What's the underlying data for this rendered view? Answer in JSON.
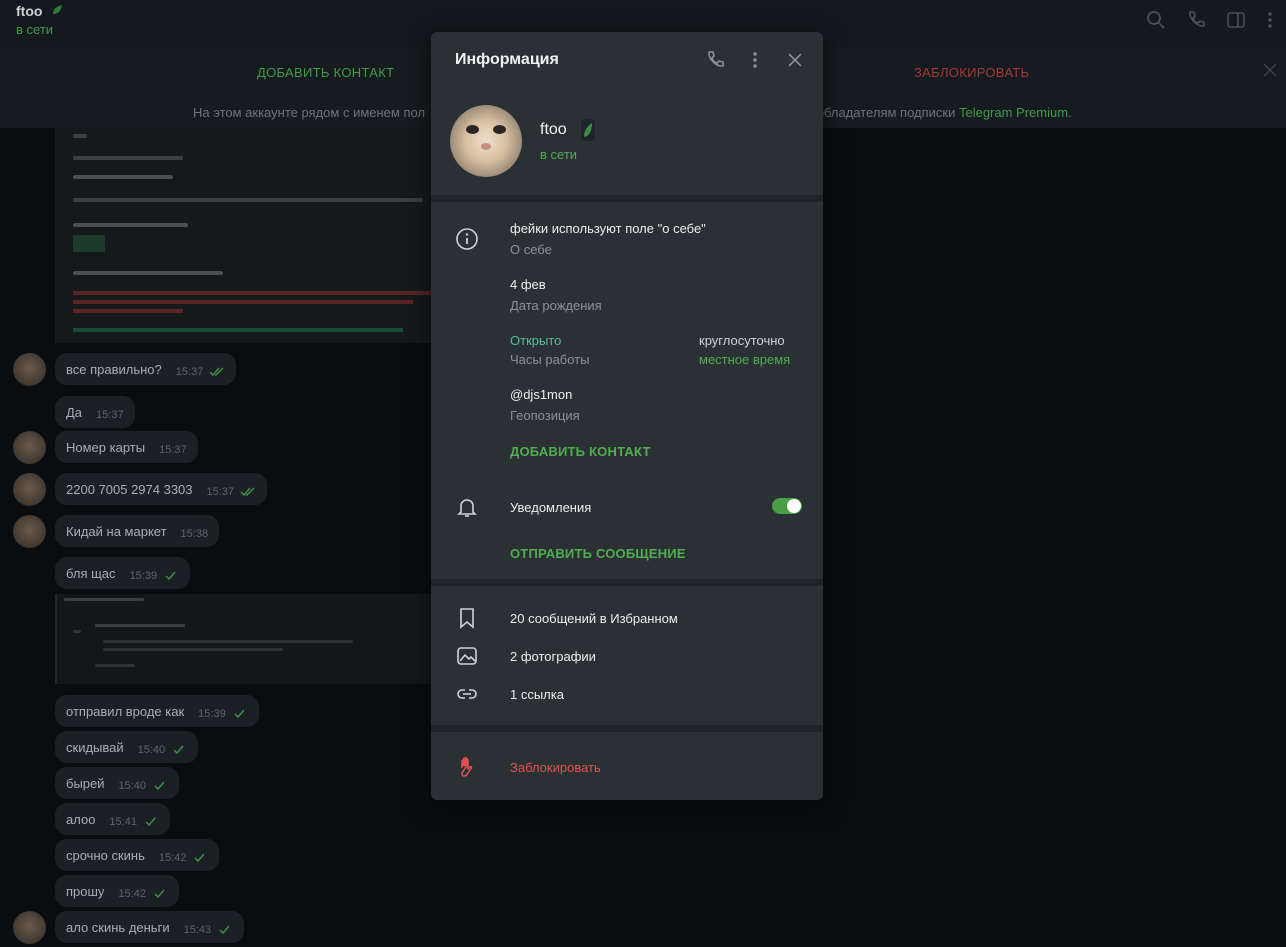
{
  "chat": {
    "contact_name": "ftoo",
    "contact_status": "в сети",
    "action_add": "ДОБАВИТЬ КОНТАКТ",
    "action_block": "ЗАБЛОКИРОВАТЬ",
    "note_prefix": "На этом аккаунте рядом с именем пол",
    "note_suffix": "ем обладателям подписки ",
    "note_premium": "Telegram Premium.",
    "messages": [
      {
        "text": "все правильно?",
        "time": "15:37",
        "checks": "double"
      },
      {
        "text": "Да",
        "time": "15:37",
        "checks": "none"
      },
      {
        "text": "Номер карты",
        "time": "15:37",
        "checks": "none"
      },
      {
        "text": "2200 7005 2974 3303",
        "time": "15:37",
        "checks": "double"
      },
      {
        "text": "Кидай на маркет",
        "time": "15:38",
        "checks": "none"
      },
      {
        "text": "бля щас",
        "time": "15:39",
        "checks": "single"
      },
      {
        "text": "отправил вроде как",
        "time": "15:39",
        "checks": "single"
      },
      {
        "text": "скидывай",
        "time": "15:40",
        "checks": "single"
      },
      {
        "text": "бырей",
        "time": "15:40",
        "checks": "single"
      },
      {
        "text": "алоо",
        "time": "15:41",
        "checks": "single"
      },
      {
        "text": "срочно скинь",
        "time": "15:42",
        "checks": "single"
      },
      {
        "text": "прошу",
        "time": "15:42",
        "checks": "single"
      },
      {
        "text": "ало скинь деньги",
        "time": "15:43",
        "checks": "single"
      }
    ]
  },
  "modal": {
    "title": "Информация",
    "name": "ftoo",
    "status": "в сети",
    "bio": "фейки используют поле \"о себе\"",
    "bio_label": "О себе",
    "birthday": "4 фев",
    "birthday_label": "Дата рождения",
    "hours_status": "Открыто",
    "hours_label": "Часы работы",
    "hours_value": "круглосуточно",
    "hours_timezone": "местное время",
    "username": "@djs1mon",
    "username_label": "Геопозиция",
    "add_contact": "ДОБАВИТЬ КОНТАКТ",
    "notifications_label": "Уведомления",
    "notifications_on": true,
    "send_message": "ОТПРАВИТЬ СООБЩЕНИЕ",
    "saved_messages": "20 сообщений в Избранном",
    "photos": "2 фотографии",
    "links": "1 ссылка",
    "block": "Заблокировать"
  },
  "colors": {
    "accent_green": "#4fae4e",
    "danger_red": "#e0524f",
    "modal_bg": "#2b3035"
  }
}
